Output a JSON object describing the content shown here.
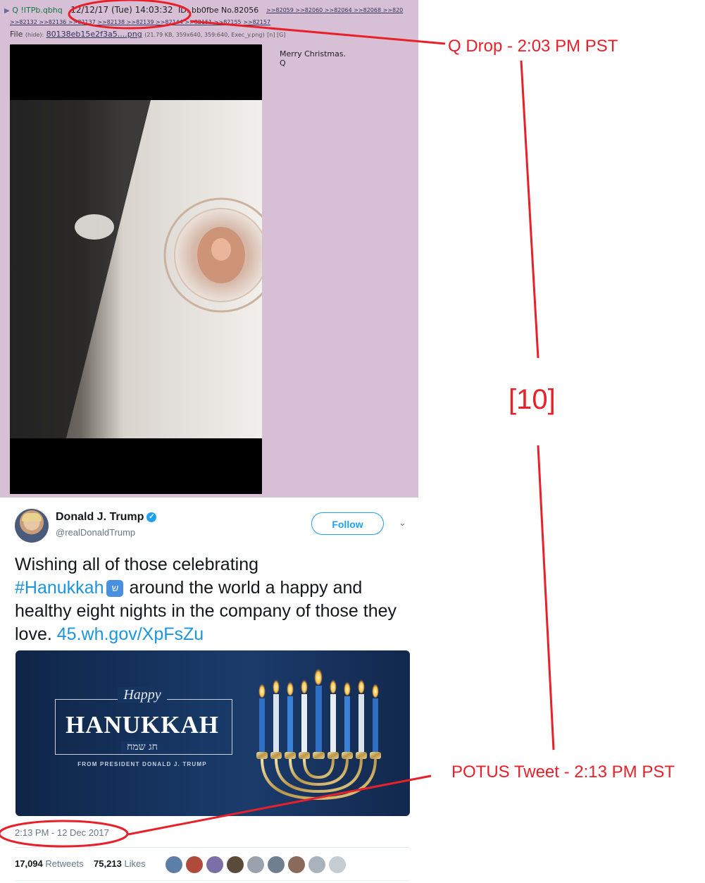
{
  "q_post": {
    "poster": "Q !ITPb.qbhq",
    "date": "12/12/17 (Tue) 14:03:32",
    "id_and_no": "ID: bb0fbe No.82056",
    "reply_links_1": ">>82059 >>82060 >>82064 >>82068 >>820",
    "reply_links_2": ">>82132 >>82136 >>82137 >>82138 >>82139 >>82144 >>82151 >>82155 >>82157",
    "file_label": "File",
    "file_hide": "(hide):",
    "file_name": "80138eb15e2f3a5....png",
    "file_meta": "(21.79 KB, 359x640, 359:640, Exec_y.png)",
    "file_tools": "[n] [G]",
    "message_line1": "Merry Christmas.",
    "message_line2": "Q"
  },
  "tweet": {
    "display_name": "Donald J. Trump",
    "handle": "@realDonaldTrump",
    "follow_label": "Follow",
    "text_part1": "Wishing all of those celebrating",
    "hashtag": "#Hanukkah",
    "text_part2": "around the world a happy and healthy eight nights in the company of those they love.",
    "link": "45.wh.gov/XpFsZu",
    "card": {
      "happy": "Happy",
      "title": "HANUKKAH",
      "hebrew": "חג שמח",
      "from": "FROM PRESIDENT DONALD J. TRUMP"
    },
    "timestamp": "2:13 PM - 12 Dec 2017",
    "retweets_count": "17,094",
    "retweets_label": "Retweets",
    "likes_count": "75,213",
    "likes_label": "Likes",
    "liker_colors": [
      "#5b7fa6",
      "#b04a3a",
      "#7a6fa6",
      "#5a4a3a",
      "#9aa3ad",
      "#6f7f8f",
      "#8a6a5a",
      "#aab3bd",
      "#c5ccd3"
    ]
  },
  "annotations": {
    "q_drop": "Q Drop - 2:03 PM PST",
    "gap": "[10]",
    "potus_tweet": "POTUS Tweet - 2:13 PM PST",
    "color": "#e8202a"
  }
}
